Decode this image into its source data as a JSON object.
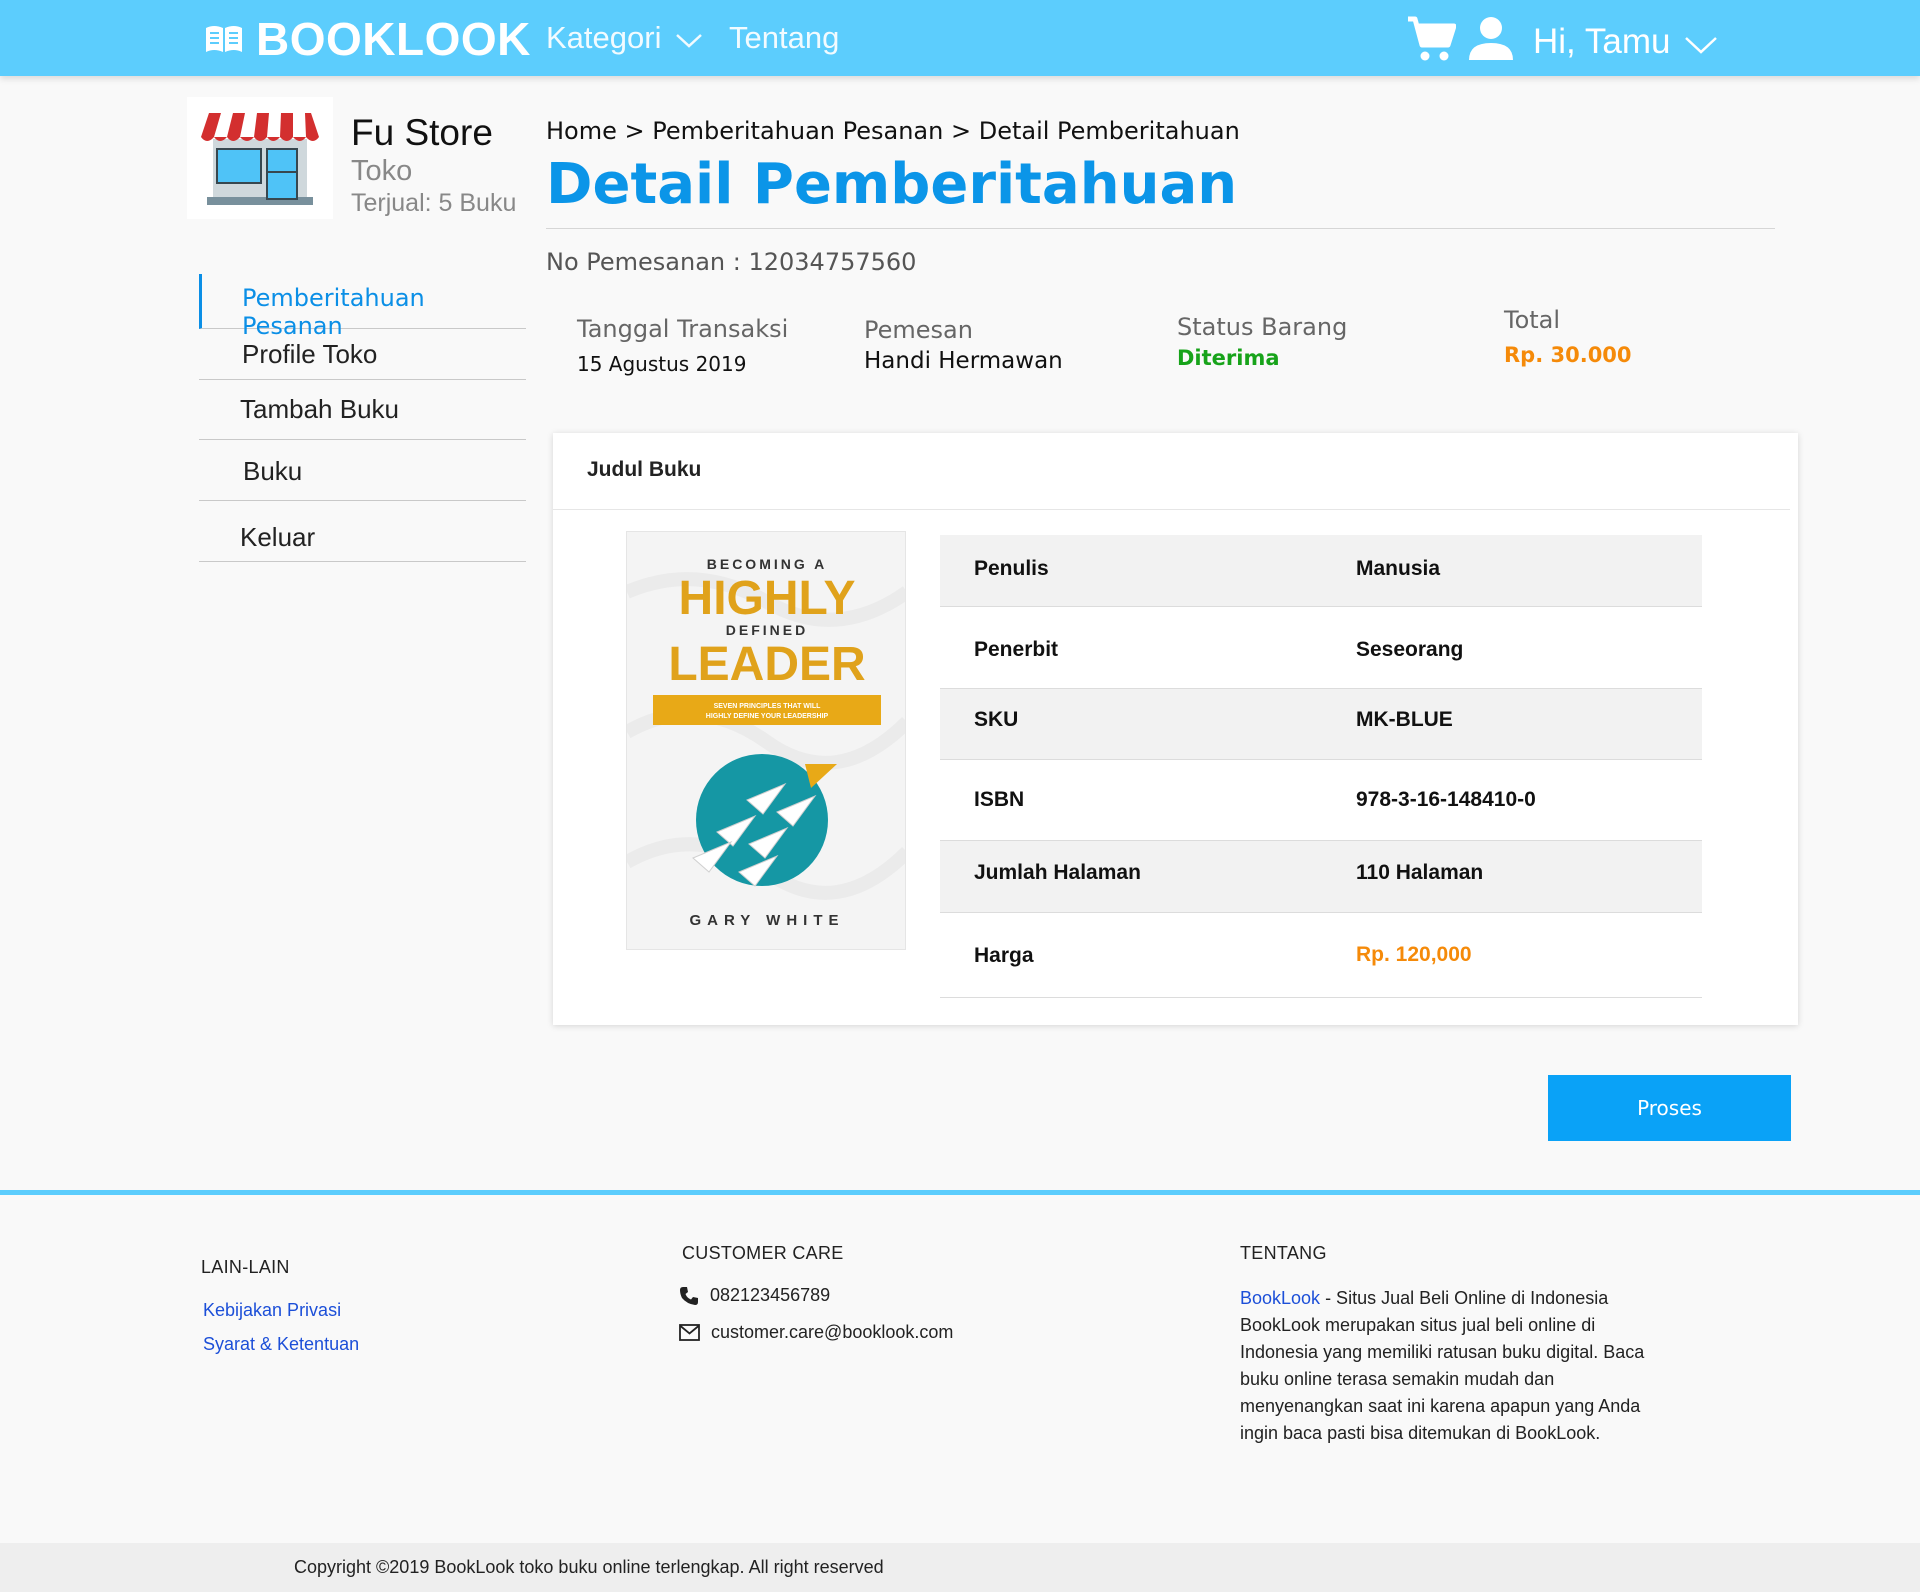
{
  "header": {
    "brand": "BOOKLOOK",
    "nav": {
      "kategori": "Kategori",
      "tentang": "Tentang"
    },
    "greeting": "Hi, Tamu"
  },
  "store": {
    "name": "Fu Store",
    "type": "Toko",
    "sold": "Terjual: 5 Buku"
  },
  "sidebar": {
    "items": [
      {
        "label": "Pemberitahuan Pesanan"
      },
      {
        "label": "Profile Toko"
      },
      {
        "label": "Tambah Buku"
      },
      {
        "label": "Buku"
      },
      {
        "label": "Keluar"
      }
    ]
  },
  "main": {
    "breadcrumb": "Home > Pemberitahuan Pesanan > Detail Pemberitahuan",
    "title": "Detail Pemberitahuan",
    "order_no": "No Pemesanan : 12034757560",
    "info": {
      "tanggal_label": "Tanggal Transaksi",
      "tanggal_value": "15 Agustus 2019",
      "pemesan_label": "Pemesan",
      "pemesan_value": "Handi Hermawan",
      "status_label": "Status Barang",
      "status_value": "Diterima",
      "total_label": "Total",
      "total_value": "Rp. 30.000"
    },
    "card_title": "Judul Buku",
    "cover": {
      "line1": "BECOMING A",
      "line2": "HIGHLY",
      "line3": "DEFINED",
      "line4": "LEADER",
      "banner1": "SEVEN PRINCIPLES THAT WILL",
      "banner2": "HIGHLY DEFINE YOUR LEADERSHIP",
      "author": "GARY WHITE"
    },
    "specs": [
      {
        "key": "Penulis",
        "value": "Manusia"
      },
      {
        "key": "Penerbit",
        "value": "Seseorang"
      },
      {
        "key": "SKU",
        "value": "MK-BLUE"
      },
      {
        "key": "ISBN",
        "value": "978-3-16-148410-0"
      },
      {
        "key": "Jumlah Halaman",
        "value": "110 Halaman"
      },
      {
        "key": "Harga",
        "value": "Rp. 120,000"
      }
    ],
    "process_button": "Proses"
  },
  "footer": {
    "lain_heading": "LAIN-LAIN",
    "links": [
      "Kebijakan Privasi",
      "Syarat & Ketentuan"
    ],
    "care_heading": "CUSTOMER CARE",
    "phone": "082123456789",
    "email": "customer.care@booklook.com",
    "tentang_heading": "TENTANG",
    "about_brand": "BookLook",
    "about_text": " - Situs Jual Beli Online di Indonesia BookLook merupakan situs jual beli online di Indonesia yang memiliki ratusan buku digital. Baca buku online terasa semakin mudah dan menyenangkan saat ini karena apapun yang Anda ingin baca pasti bisa ditemukan di BookLook.",
    "copyright": "Copyright ©2019 BookLook toko buku online terlengkap. All right reserved"
  },
  "colors": {
    "header": "#5ccdfd",
    "accent": "#0b95e8",
    "status_green": "#17a31a",
    "price_orange": "#f58a09",
    "button": "#0aa2f7"
  }
}
